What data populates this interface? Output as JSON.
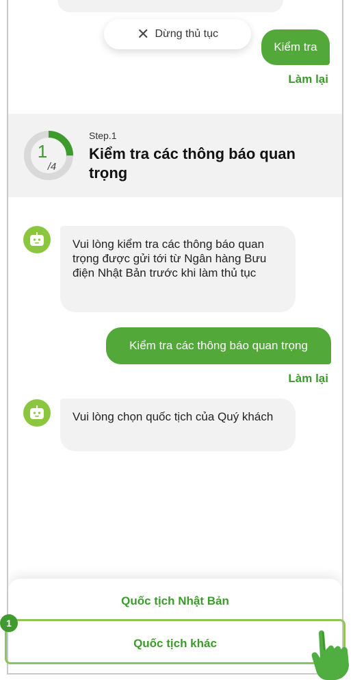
{
  "chat": {
    "stop_button_label": "Dừng thủ tục",
    "user_reply_1": "Kiểm tra",
    "retry_label_1": "Làm lại",
    "bot_message_1": "Vui lòng kiểm tra các thông báo quan trọng được gửi tới từ Ngân hàng Bưu điện Nhật Bản trước khi làm thủ tục",
    "user_reply_2": "Kiểm tra các thông báo quan trọng",
    "retry_label_2": "Làm lại",
    "bot_message_2": "Vui lòng chọn quốc tịch của Quý khách"
  },
  "step": {
    "current": "1",
    "total": "/4",
    "progress": 0.25,
    "label": "Step.1",
    "title": "Kiểm tra các thông báo quan trọng"
  },
  "options": [
    "Quốc tịch Nhật Bản",
    "Quốc tịch khác"
  ],
  "annotation": {
    "badge": "1"
  },
  "colors": {
    "accent": "#3d9a2d",
    "bubble_green": "#53a83a",
    "bot_avatar": "#8cc63f",
    "highlight": "#8fc45a",
    "panel_gray": "#f2f2f2"
  },
  "icons": {
    "stop": "close-icon",
    "avatar": "robot-icon",
    "pointer": "hand-pointer-icon"
  }
}
